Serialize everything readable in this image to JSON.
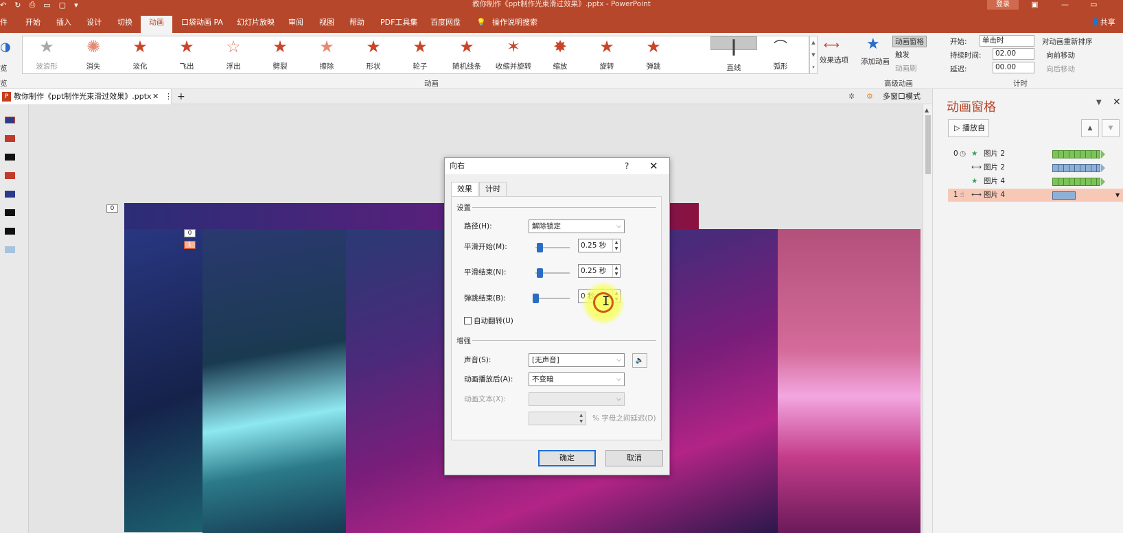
{
  "titlebar": {
    "title": "教你制作《ppt制作光束滑过效果》.pptx - PowerPoint",
    "login": "登录",
    "quick_access": [
      "↶",
      "↻",
      "⎙",
      "▭",
      "▢",
      "▾"
    ],
    "window_buttons": [
      "▣",
      "—",
      "▭"
    ]
  },
  "ribbon_tabs": [
    "件",
    "开始",
    "插入",
    "设计",
    "切换",
    "动画",
    "口袋动画 PA",
    "幻灯片放映",
    "审阅",
    "视图",
    "帮助",
    "PDF工具集",
    "百度网盘",
    "操作说明搜索"
  ],
  "active_tab": "动画",
  "share": "共享",
  "ribbon": {
    "preview_label": "览",
    "preview_group": "览",
    "gallery": [
      {
        "label": "波浪形",
        "dim": true
      },
      {
        "label": "消失"
      },
      {
        "label": "淡化"
      },
      {
        "label": "飞出"
      },
      {
        "label": "浮出"
      },
      {
        "label": "劈裂"
      },
      {
        "label": "擦除"
      },
      {
        "label": "形状"
      },
      {
        "label": "轮子"
      },
      {
        "label": "随机线条"
      },
      {
        "label": "收缩并旋转"
      },
      {
        "label": "缩放"
      },
      {
        "label": "旋转"
      },
      {
        "label": "弹跳"
      },
      {
        "label": "直线",
        "selected": true
      },
      {
        "label": "弧形"
      }
    ],
    "group_animation": "动画",
    "effect_options": "效果选项",
    "add_animation": "添加动画",
    "animation_pane_btn": "动画窗格",
    "trigger": "触发",
    "animation_painter": "动画刷",
    "group_advanced": "高级动画",
    "start_label": "开始:",
    "start_value": "单击时",
    "duration_label": "持续时间:",
    "duration_value": "02.00",
    "delay_label": "延迟:",
    "delay_value": "00.00",
    "reorder_title": "对动画重新排序",
    "move_earlier": "向前移动",
    "move_later": "向后移动",
    "group_timing": "计时"
  },
  "doc_tab": {
    "badge": "P",
    "name": "教你制作《ppt制作光束滑过效果》.pptx",
    "close": "✕",
    "more": "⋮",
    "add": "+"
  },
  "multiwindow": "多窗口模式",
  "slide_tags": {
    "top": "0",
    "mid": "0",
    "orange": "1"
  },
  "dialog": {
    "title": "向右",
    "help": "?",
    "close": "✕",
    "tabs": [
      "效果",
      "计时"
    ],
    "section_settings": "设置",
    "path_label": "路径(H):",
    "path_value": "解除锁定",
    "smooth_start_label": "平滑开始(M):",
    "smooth_start_value": "0.25 秒",
    "smooth_end_label": "平滑结束(N):",
    "smooth_end_value": "0.25 秒",
    "bounce_end_label": "弹跳结束(B):",
    "bounce_end_value": "0 秒",
    "auto_reverse_label": "自动翻转(U)",
    "section_enhance": "增强",
    "sound_label": "声音(S):",
    "sound_value": "[无声音]",
    "after_anim_label": "动画播放后(A):",
    "after_anim_value": "不变暗",
    "anim_text_label": "动画文本(X):",
    "anim_text_value": "",
    "delay_between_label": "% 字母之间延迟(D)",
    "delay_between_value": "",
    "ok": "确定",
    "cancel": "取消"
  },
  "animation_pane": {
    "title": "动画窗格",
    "play_from": "播放自",
    "items": [
      {
        "num": "0",
        "icon": "★",
        "name": "图片 2",
        "bar": "green"
      },
      {
        "num": "",
        "icon": "⟷",
        "name": "图片 2",
        "bar": "blue"
      },
      {
        "num": "",
        "icon": "★",
        "name": "图片 4",
        "bar": "green"
      },
      {
        "num": "1",
        "icon": "⟷",
        "name": "图片 4",
        "bar": "blueplain",
        "selected": true
      }
    ]
  },
  "colors": {
    "accent": "#b7472a",
    "ribbon_bg": "#f3f3f3",
    "selected_row": "#f8c8b6",
    "green_bar": "#7cc35a",
    "blue_bar": "#8eb0d4",
    "default_button": "#1f6ed4"
  }
}
